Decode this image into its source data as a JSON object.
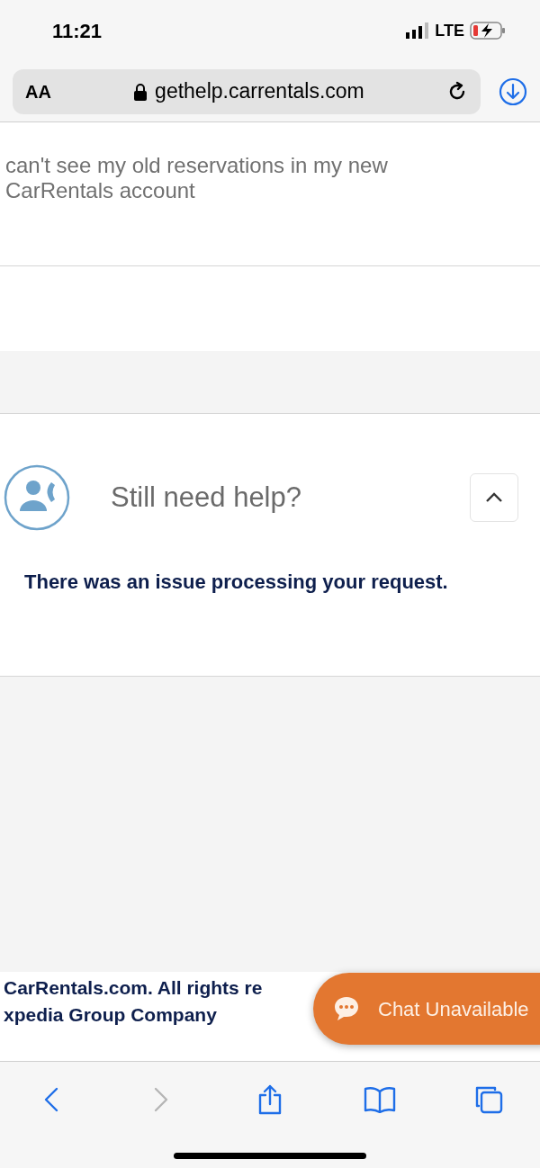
{
  "status_bar": {
    "time": "11:21",
    "network": "LTE"
  },
  "address_bar": {
    "text_size_label": "AA",
    "url": "gethelp.carrentals.com"
  },
  "faq": {
    "question_lines": [
      "can't see my old reservations in my new",
      "CarRentals account"
    ]
  },
  "help_panel": {
    "title": "Still need help?",
    "expanded": true,
    "message": "There was an issue processing your request."
  },
  "footer": {
    "lines": [
      "CarRentals.com. All rights re",
      "xpedia Group Company"
    ]
  },
  "chat_button": {
    "label": "Chat Unavailable"
  },
  "toolbar": [
    {
      "kind": "back",
      "disabled": false
    },
    {
      "kind": "forward",
      "disabled": true
    },
    {
      "kind": "share",
      "disabled": false
    },
    {
      "kind": "bookmarks",
      "disabled": false
    },
    {
      "kind": "tabs",
      "disabled": false
    }
  ]
}
